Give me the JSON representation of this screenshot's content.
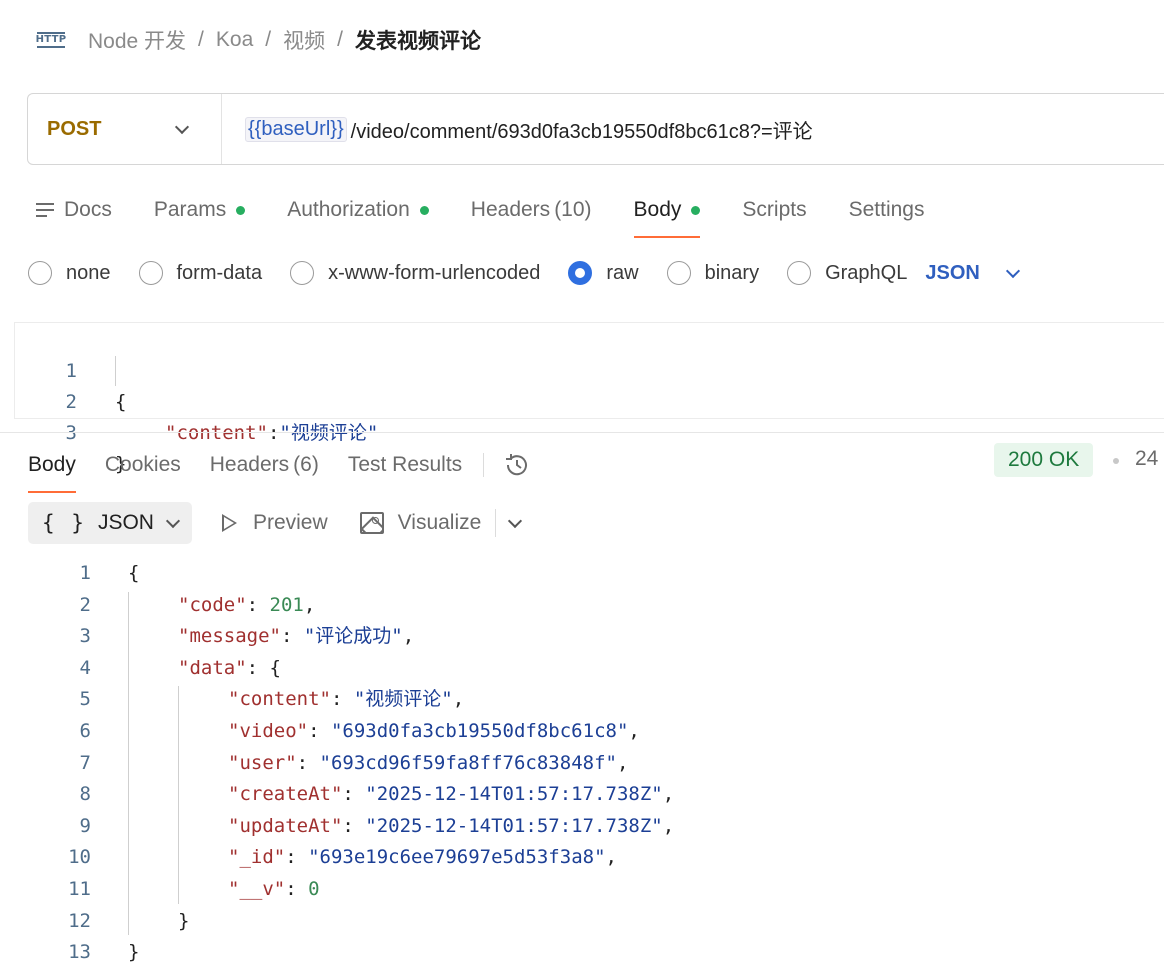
{
  "breadcrumb": {
    "icon": "http-icon",
    "icon_text": "HTTP",
    "items": [
      "Node 开发",
      "Koa",
      "视频"
    ],
    "separator": "/",
    "current": "发表视频评论"
  },
  "request": {
    "method": "POST",
    "url_variable": "{{baseUrl}}",
    "url_path": "/video/comment/693d0fa3cb19550df8bc61c8?=评论"
  },
  "request_tabs": [
    {
      "label": "Docs",
      "icon": "docs-icon"
    },
    {
      "label": "Params",
      "dot": true
    },
    {
      "label": "Authorization",
      "dot": true
    },
    {
      "label": "Headers",
      "count": "(10)"
    },
    {
      "label": "Body",
      "dot": true,
      "active": true
    },
    {
      "label": "Scripts"
    },
    {
      "label": "Settings"
    }
  ],
  "body_types": [
    {
      "label": "none",
      "checked": false
    },
    {
      "label": "form-data",
      "checked": false
    },
    {
      "label": "x-www-form-urlencoded",
      "checked": false
    },
    {
      "label": "raw",
      "checked": true
    },
    {
      "label": "binary",
      "checked": false
    },
    {
      "label": "GraphQL",
      "checked": false
    }
  ],
  "body_format": "JSON",
  "request_body_lines": [
    {
      "n": "1",
      "text": "{"
    },
    {
      "n": "2",
      "key": "\"content\"",
      "sep": ":",
      "value": "\"视频评论\""
    },
    {
      "n": "3",
      "text": "}"
    }
  ],
  "response_tabs": [
    {
      "label": "Body",
      "active": true
    },
    {
      "label": "Cookies"
    },
    {
      "label": "Headers",
      "count": "(6)"
    },
    {
      "label": "Test Results"
    }
  ],
  "status": {
    "text": "200 OK",
    "color": "#1e7a3e",
    "time_truncated": "24"
  },
  "response_toolbar": {
    "format_icon": "{ }",
    "format": "JSON",
    "preview": "Preview",
    "visualize": "Visualize"
  },
  "response_lines": [
    {
      "n": "1",
      "parts": [
        [
          "punc",
          "{"
        ]
      ]
    },
    {
      "n": "2",
      "parts": [
        [
          "key",
          "\"code\""
        ],
        [
          "punc",
          ": "
        ],
        [
          "num",
          "201"
        ],
        [
          "punc",
          ","
        ]
      ]
    },
    {
      "n": "3",
      "parts": [
        [
          "key",
          "\"message\""
        ],
        [
          "punc",
          ": "
        ],
        [
          "str",
          "\"评论成功\""
        ],
        [
          "punc",
          ","
        ]
      ]
    },
    {
      "n": "4",
      "parts": [
        [
          "key",
          "\"data\""
        ],
        [
          "punc",
          ": {"
        ]
      ]
    },
    {
      "n": "5",
      "parts": [
        [
          "key",
          "\"content\""
        ],
        [
          "punc",
          ": "
        ],
        [
          "str",
          "\"视频评论\""
        ],
        [
          "punc",
          ","
        ]
      ]
    },
    {
      "n": "6",
      "parts": [
        [
          "key",
          "\"video\""
        ],
        [
          "punc",
          ": "
        ],
        [
          "str",
          "\"693d0fa3cb19550df8bc61c8\""
        ],
        [
          "punc",
          ","
        ]
      ]
    },
    {
      "n": "7",
      "parts": [
        [
          "key",
          "\"user\""
        ],
        [
          "punc",
          ": "
        ],
        [
          "str",
          "\"693cd96f59fa8ff76c83848f\""
        ],
        [
          "punc",
          ","
        ]
      ]
    },
    {
      "n": "8",
      "parts": [
        [
          "key",
          "\"createAt\""
        ],
        [
          "punc",
          ": "
        ],
        [
          "str",
          "\"2025-12-14T01:57:17.738Z\""
        ],
        [
          "punc",
          ","
        ]
      ]
    },
    {
      "n": "9",
      "parts": [
        [
          "key",
          "\"updateAt\""
        ],
        [
          "punc",
          ": "
        ],
        [
          "str",
          "\"2025-12-14T01:57:17.738Z\""
        ],
        [
          "punc",
          ","
        ]
      ]
    },
    {
      "n": "10",
      "parts": [
        [
          "key",
          "\"_id\""
        ],
        [
          "punc",
          ": "
        ],
        [
          "str",
          "\"693e19c6ee79697e5d53f3a8\""
        ],
        [
          "punc",
          ","
        ]
      ]
    },
    {
      "n": "11",
      "parts": [
        [
          "key",
          "\"__v\""
        ],
        [
          "punc",
          ": "
        ],
        [
          "num",
          "0"
        ]
      ]
    },
    {
      "n": "12",
      "parts": [
        [
          "punc",
          "}"
        ]
      ]
    },
    {
      "n": "13",
      "parts": [
        [
          "punc",
          "}"
        ]
      ]
    }
  ]
}
